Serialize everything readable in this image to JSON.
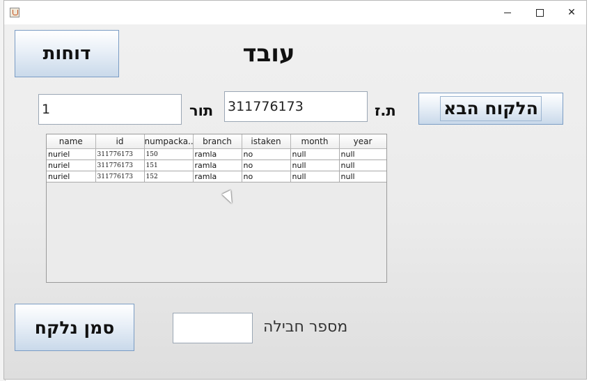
{
  "window": {
    "controls": {
      "minimize": "—",
      "maximize": "☐",
      "close": "✕"
    }
  },
  "header": {
    "title": "עובד",
    "reports_button": "דוחות"
  },
  "form": {
    "id_label": "ת.ז",
    "id_value": "311776173",
    "queue_label": "תור",
    "queue_value": "1",
    "next_customer_button": "הלקוח הבא"
  },
  "table": {
    "columns": [
      "name",
      "id",
      "numpacka...",
      "branch",
      "istaken",
      "month",
      "year"
    ],
    "rows": [
      [
        "nuriel",
        "311776173",
        "150",
        "ramla",
        "no",
        "null",
        "null"
      ],
      [
        "nuriel",
        "311776173",
        "151",
        "ramla",
        "no",
        "null",
        "null"
      ],
      [
        "nuriel",
        "311776173",
        "152",
        "ramla",
        "no",
        "null",
        "null"
      ]
    ]
  },
  "footer": {
    "mark_taken_button": "סמן נלקח",
    "package_number_label": "מספר חבילה",
    "package_number_value": ""
  },
  "colors": {
    "button_border": "#7a9cc4",
    "panel_bg": "#ececec"
  }
}
